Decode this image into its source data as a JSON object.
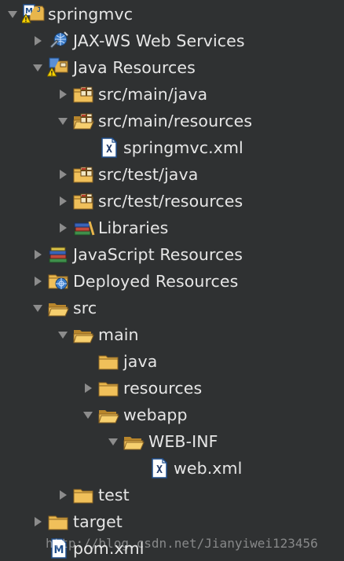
{
  "tree": {
    "items": [
      {
        "label": "springmvc",
        "level": 0,
        "state": "expanded",
        "icon": "maven-project-icon"
      },
      {
        "label": "JAX-WS Web Services",
        "level": 1,
        "state": "collapsed",
        "icon": "web-services-icon"
      },
      {
        "label": "Java Resources",
        "level": 1,
        "state": "expanded",
        "icon": "java-resources-icon"
      },
      {
        "label": "src/main/java",
        "level": 2,
        "state": "collapsed",
        "icon": "package-folder-icon"
      },
      {
        "label": "src/main/resources",
        "level": 2,
        "state": "expanded",
        "icon": "package-folder-icon"
      },
      {
        "label": "springmvc.xml",
        "level": 3,
        "state": "leaf",
        "icon": "xml-file-icon"
      },
      {
        "label": "src/test/java",
        "level": 2,
        "state": "collapsed",
        "icon": "package-folder-icon"
      },
      {
        "label": "src/test/resources",
        "level": 2,
        "state": "collapsed",
        "icon": "package-folder-icon"
      },
      {
        "label": "Libraries",
        "level": 2,
        "state": "collapsed",
        "icon": "libraries-icon"
      },
      {
        "label": "JavaScript Resources",
        "level": 1,
        "state": "collapsed",
        "icon": "javascript-resources-icon"
      },
      {
        "label": "Deployed Resources",
        "level": 1,
        "state": "collapsed",
        "icon": "deployed-resources-icon"
      },
      {
        "label": "src",
        "level": 1,
        "state": "expanded",
        "icon": "folder-icon"
      },
      {
        "label": "main",
        "level": 2,
        "state": "expanded",
        "icon": "folder-icon"
      },
      {
        "label": "java",
        "level": 3,
        "state": "leaf",
        "icon": "folder-icon"
      },
      {
        "label": "resources",
        "level": 3,
        "state": "collapsed",
        "icon": "folder-icon"
      },
      {
        "label": "webapp",
        "level": 3,
        "state": "expanded",
        "icon": "folder-icon"
      },
      {
        "label": "WEB-INF",
        "level": 4,
        "state": "expanded",
        "icon": "folder-icon"
      },
      {
        "label": "web.xml",
        "level": 5,
        "state": "leaf",
        "icon": "xml-file-icon"
      },
      {
        "label": "test",
        "level": 2,
        "state": "collapsed",
        "icon": "folder-icon"
      },
      {
        "label": "target",
        "level": 1,
        "state": "collapsed",
        "icon": "folder-icon"
      },
      {
        "label": "pom.xml",
        "level": 1,
        "state": "leaf",
        "icon": "maven-pom-file-icon"
      }
    ]
  },
  "watermark": "http://blog.csdn.net/Jianyiwei123456",
  "colors": {
    "background": "#2f3132",
    "text": "#e6e6e6",
    "twistie": "#8c8c8c",
    "folder": "#e8b64c",
    "xml_file_border": "#1f4e8c"
  }
}
